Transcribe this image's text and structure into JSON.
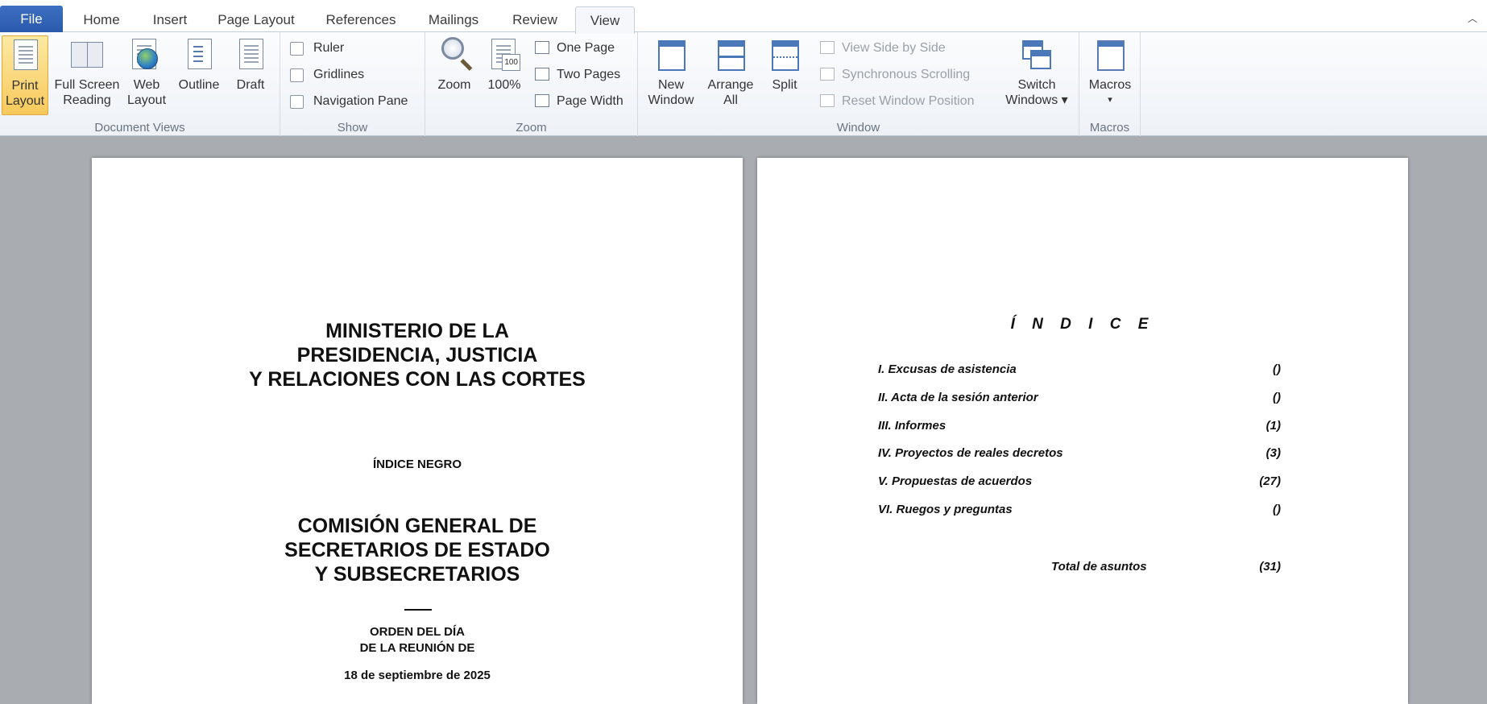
{
  "tabs": [
    "File",
    "Home",
    "Insert",
    "Page Layout",
    "References",
    "Mailings",
    "Review",
    "View"
  ],
  "ribbon": {
    "document_views": {
      "label": "Document Views",
      "print_layout": [
        "Print",
        "Layout"
      ],
      "full_screen": [
        "Full Screen",
        "Reading"
      ],
      "web_layout": [
        "Web",
        "Layout"
      ],
      "outline": "Outline",
      "draft": "Draft"
    },
    "show": {
      "label": "Show",
      "ruler": "Ruler",
      "gridlines": "Gridlines",
      "navigation_pane": "Navigation Pane"
    },
    "zoom": {
      "label": "Zoom",
      "zoom": "Zoom",
      "hundred": "100%",
      "one_page": "One Page",
      "two_pages": "Two Pages",
      "page_width": "Page Width"
    },
    "window": {
      "label": "Window",
      "new_window": [
        "New",
        "Window"
      ],
      "arrange_all": [
        "Arrange",
        "All"
      ],
      "split": "Split",
      "view_side_by_side": "View Side by Side",
      "synchronous_scrolling": "Synchronous Scrolling",
      "reset_window_position": "Reset Window Position",
      "switch_windows": [
        "Switch",
        "Windows ▾"
      ]
    },
    "macros": {
      "label": "Macros",
      "macros": "Macros",
      "arrow": "▾"
    }
  },
  "page1": {
    "title": [
      "MINISTERIO DE LA",
      "PRESIDENCIA, JUSTICIA",
      "Y RELACIONES CON LAS CORTES"
    ],
    "indice_negro": "ÍNDICE NEGRO",
    "commission": [
      "COMISIÓN GENERAL DE",
      "SECRETARIOS DE ESTADO",
      "Y SUBSECRETARIOS"
    ],
    "orden": [
      "ORDEN DEL DÍA",
      "DE LA REUNIÓN DE"
    ],
    "date": "18 de septiembre de 2025"
  },
  "page2": {
    "heading": "Í N D I C E",
    "items": [
      {
        "label": "I. Excusas de asistencia",
        "count": "()"
      },
      {
        "label": "II. Acta de la sesión anterior",
        "count": "()"
      },
      {
        "label": "III.  Informes",
        "count": "(1)"
      },
      {
        "label": "IV. Proyectos de reales decretos",
        "count": "(3)"
      },
      {
        "label": "V. Propuestas de acuerdos",
        "count": "(27)"
      },
      {
        "label": "VI. Ruegos y preguntas",
        "count": "()"
      }
    ],
    "total_label": "Total de asuntos",
    "total_count": "(31)"
  },
  "colors": {
    "file_tab": "#2a5aab",
    "selected_button": "#f7c95c",
    "workspace": "#a9acb1"
  }
}
